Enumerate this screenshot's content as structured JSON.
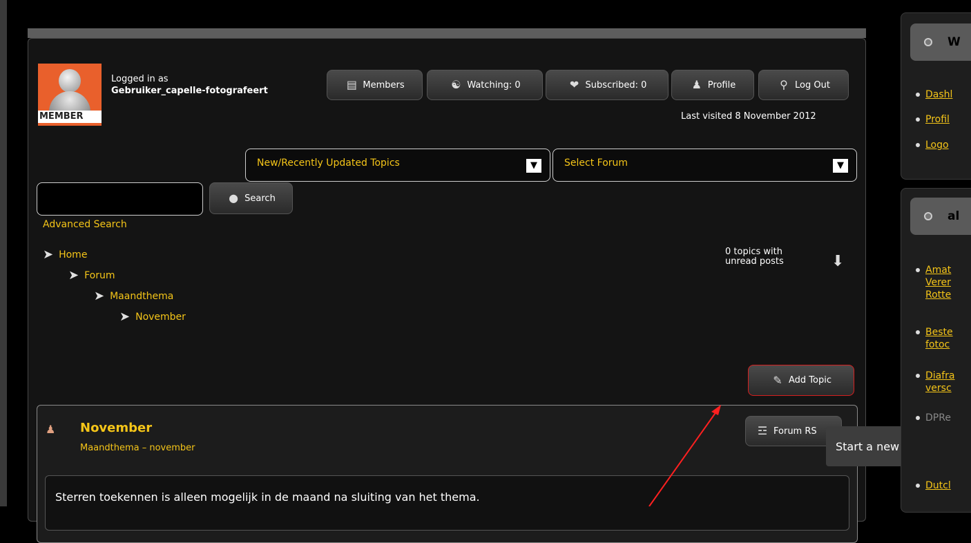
{
  "user": {
    "logged_in_label": "Logged in as",
    "username": "Gebruiker_capelle-fotografeert",
    "avatar_tag": "MEMBER",
    "last_visited": "Last visited 8 November 2012"
  },
  "toolbar": {
    "members": "Members",
    "watching": "Watching: 0",
    "subscribed": "Subscribed: 0",
    "profile": "Profile",
    "logout": "Log Out"
  },
  "selects": {
    "topics": "New/Recently Updated Topics",
    "forum": "Select Forum"
  },
  "search": {
    "button": "Search",
    "advanced": "Advanced Search",
    "value": ""
  },
  "breadcrumb": [
    "Home",
    "Forum",
    "Maandthema",
    "November"
  ],
  "unread": "0 topics with\nunread posts",
  "add_topic": "Add Topic",
  "forum": {
    "title": "November",
    "subtitle": "Maandthema – november",
    "rss": "Forum RS",
    "notice": "Sterren toekennen is alleen mogelijk in de maand na sluiting van het thema."
  },
  "tooltip": "Start a new topic",
  "sidebar": {
    "panel1_head": "W",
    "panel1_items": [
      "Dashl",
      "Profil",
      "Logo"
    ],
    "panel2_head": "al",
    "panel2_items": [
      "Amat\nVerer\nRotte",
      "Beste\nfotoc",
      "Diafra\nversc",
      "DPRe",
      "Dutcl"
    ]
  },
  "colors": {
    "accent": "#f5c518",
    "avatar_bg": "#e9602c",
    "annotation": "#ff2020"
  }
}
